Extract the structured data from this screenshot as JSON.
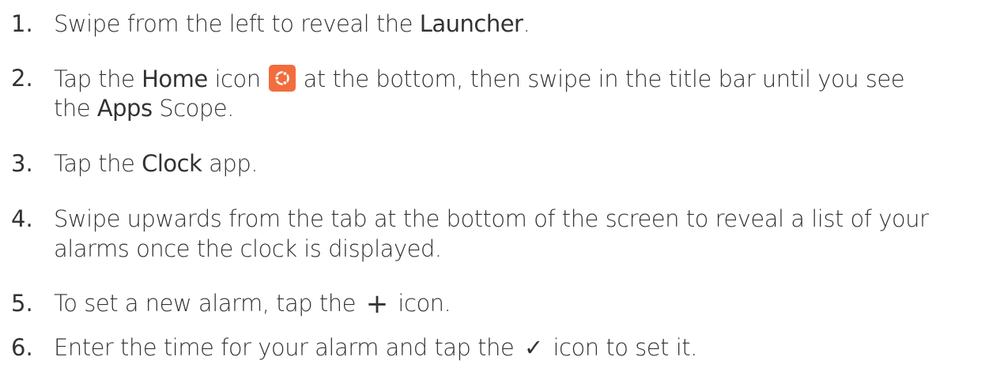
{
  "steps": [
    {
      "number": "1.",
      "parts": {
        "a": "Swipe from the left to reveal the ",
        "b": "Launcher",
        "c": "."
      }
    },
    {
      "number": "2.",
      "parts": {
        "a": "Tap the ",
        "b": "Home",
        "c": " icon",
        "d": "at the bottom, then swipe in the title bar until you see",
        "e": "the ",
        "f": "Apps",
        "g": " Scope."
      },
      "icon": "ubuntu-home-icon"
    },
    {
      "number": "3.",
      "parts": {
        "a": "Tap the ",
        "b": "Clock",
        "c": " app."
      }
    },
    {
      "number": "4.",
      "parts": {
        "a": "Swipe upwards from the tab at the bottom of the screen to reveal a list of your",
        "b": "alarms once the clock is displayed."
      }
    },
    {
      "number": "5.",
      "parts": {
        "a": "To set a new alarm, tap the ",
        "glyph": "+",
        "c": " icon."
      },
      "icon": "plus-icon"
    },
    {
      "number": "6.",
      "parts": {
        "a": "Enter the time for your alarm and tap the ",
        "glyph": "✓",
        "c": " icon to set it."
      },
      "icon": "checkmark-icon"
    }
  ],
  "colors": {
    "text": "#333333",
    "icon_bg": "#f26d3d"
  }
}
